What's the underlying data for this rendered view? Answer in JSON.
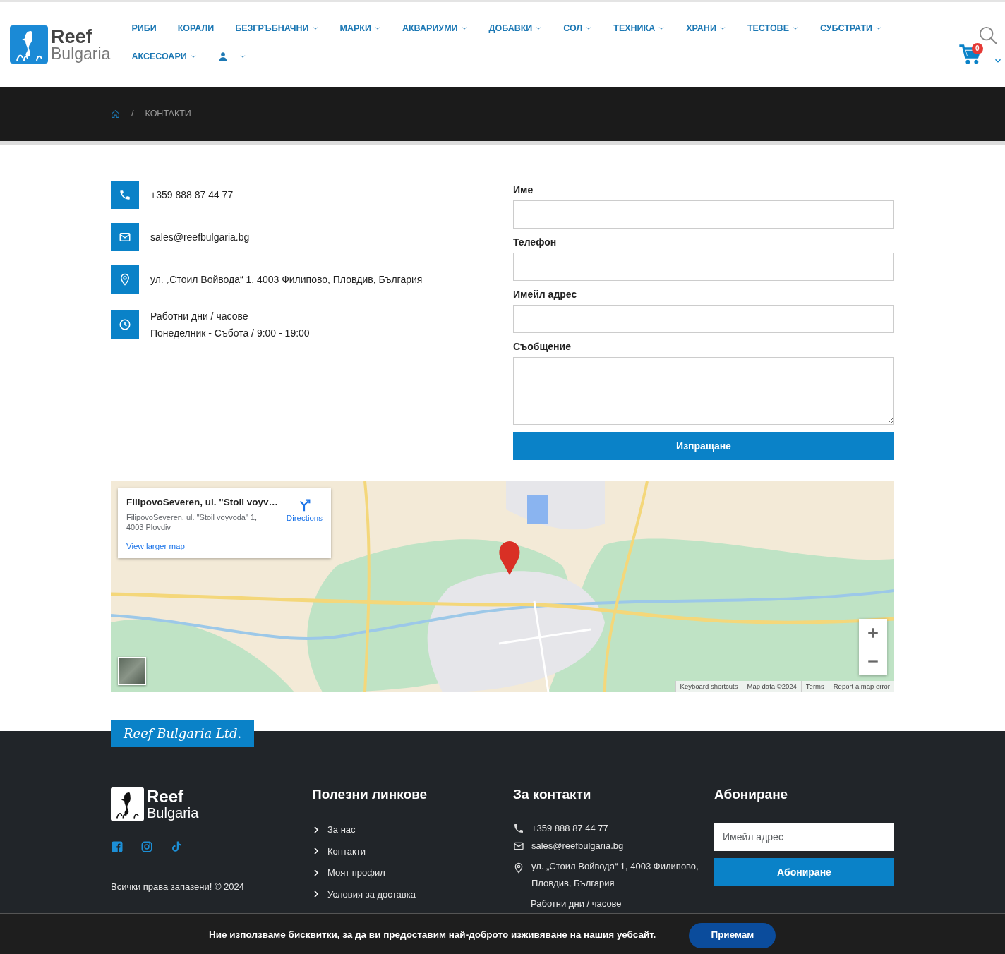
{
  "header": {
    "logo": {
      "line1": "Reef",
      "line2": "Bulgaria"
    },
    "nav": [
      {
        "label": "РИБИ",
        "dropdown": false
      },
      {
        "label": "КОРАЛИ",
        "dropdown": false
      },
      {
        "label": "БЕЗГРЪБНАЧНИ",
        "dropdown": true
      },
      {
        "label": "МАРКИ",
        "dropdown": true
      },
      {
        "label": "АКВАРИУМИ",
        "dropdown": true
      },
      {
        "label": "ДОБАВКИ",
        "dropdown": true
      },
      {
        "label": "СОЛ",
        "dropdown": true
      },
      {
        "label": "ТЕХНИКА",
        "dropdown": true
      },
      {
        "label": "ХРАНИ",
        "dropdown": true
      },
      {
        "label": "ТЕСТОВЕ",
        "dropdown": true
      },
      {
        "label": "СУБСТРАТИ",
        "dropdown": true
      },
      {
        "label": "АКСЕСОАРИ",
        "dropdown": true
      }
    ],
    "cart": {
      "count": "0"
    }
  },
  "breadcrumb": {
    "separator": "/",
    "current": "КОНТАКТИ"
  },
  "contacts": [
    {
      "kind": "phone",
      "lines": [
        "+359 888 87 44 77"
      ]
    },
    {
      "kind": "email",
      "lines": [
        "sales@reefbulgaria.bg"
      ]
    },
    {
      "kind": "address",
      "lines": [
        "ул. „Стоил Войвода“ 1, 4003 Филипово, Пловдив, България"
      ]
    },
    {
      "kind": "hours",
      "lines": [
        "Работни дни / часове",
        "Понеделник - Събота / 9:00 - 19:00"
      ]
    }
  ],
  "form": {
    "fields": [
      {
        "label": "Име",
        "kind": "input"
      },
      {
        "label": "Телефон",
        "kind": "input"
      },
      {
        "label": "Имейл адрес",
        "kind": "input"
      },
      {
        "label": "Съобщение",
        "kind": "textarea"
      }
    ],
    "submit": "Изпращане"
  },
  "map": {
    "kind": "picture",
    "info": {
      "title": "FilipovoSeveren, ul. \"Stoil voyv…",
      "address": "FilipovoSeveren, ul. \"Stoil voyvoda\" 1, 4003 Plovdiv",
      "directions": "Directions",
      "larger_link": "View larger map"
    },
    "attribution": [
      "Keyboard shortcuts",
      "Map data ©2024",
      "Terms",
      "Report a map error"
    ]
  },
  "footer": {
    "badge": "Reef Bulgaria Ltd.",
    "logo": {
      "line1": "Reef",
      "line2": "Bulgaria"
    },
    "copyright": "Всички права запазени! © 2024",
    "links": {
      "title": "Полезни линкове",
      "items": [
        "За нас",
        "Контакти",
        "Моят профил",
        "Условия за доставка"
      ]
    },
    "contacts": {
      "title": "За контакти",
      "items": [
        {
          "kind": "phone",
          "lines": [
            "+359 888 87 44 77"
          ]
        },
        {
          "kind": "email",
          "lines": [
            "sales@reefbulgaria.bg"
          ]
        },
        {
          "kind": "address",
          "lines": [
            "ул. „Стоил Войвода“ 1, 4003 Филипово,",
            "Пловдив, България"
          ]
        },
        {
          "kind": "hours",
          "lines": [
            "Работни дни / часове"
          ]
        }
      ]
    },
    "subscribe": {
      "title": "Абониране",
      "placeholder": "Имейл адрес",
      "button": "Абониране"
    }
  },
  "cookie": {
    "text": "Ние използваме бисквитки, за да ви предоставим най-доброто изживяване на нашия уебсайт.",
    "button": "Приемам"
  }
}
